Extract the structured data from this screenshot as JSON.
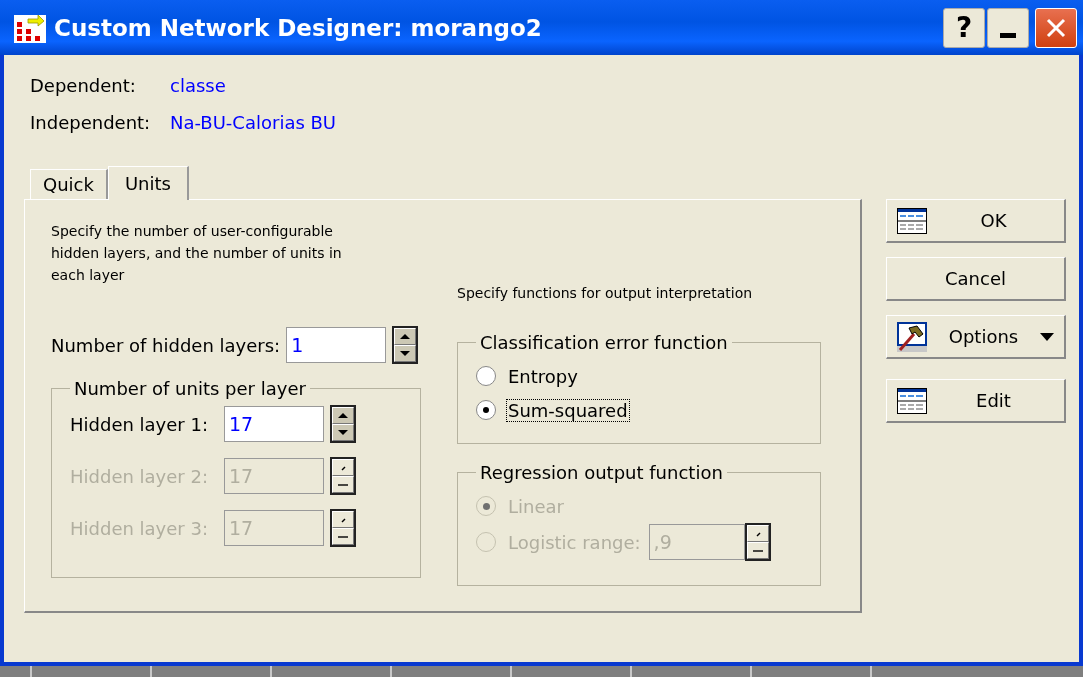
{
  "window": {
    "title": "Custom Network Designer: morango2"
  },
  "title_buttons": [
    {
      "kind": "help",
      "label": "?"
    },
    {
      "kind": "minimize"
    },
    {
      "kind": "close"
    }
  ],
  "variables": [
    {
      "label": "Dependent:",
      "value": "classe"
    },
    {
      "label": "Independent:",
      "value": "Na-BU-Calorias BU"
    }
  ],
  "tabs": [
    {
      "label": "Quick",
      "selected": false
    },
    {
      "label": "Units",
      "selected": true
    }
  ],
  "units_panel": {
    "description": "Specify the number of user-configurable hidden layers, and the number of units in each layer",
    "hidden_layers": {
      "label": "Number of hidden layers:",
      "value": "1"
    },
    "units_group": {
      "title": "Number of units per layer",
      "layers": [
        {
          "label": "Hidden layer 1:",
          "value": "17",
          "disabled": false
        },
        {
          "label": "Hidden layer 2:",
          "value": "17",
          "disabled": true
        },
        {
          "label": "Hidden layer 3:",
          "value": "17",
          "disabled": true
        }
      ]
    }
  },
  "output_panel": {
    "description": "Specify functions for output interpretation",
    "classification": {
      "title": "Classification error function",
      "options": [
        {
          "label": "Entropy",
          "selected": false,
          "disabled": false,
          "focused": false
        },
        {
          "label": "Sum-squared",
          "selected": true,
          "disabled": false,
          "focused": true
        }
      ]
    },
    "regression": {
      "title": "Regression output function",
      "options": [
        {
          "label": "Linear",
          "selected": true,
          "disabled": true,
          "focused": false
        },
        {
          "label": "Logistic range:",
          "selected": false,
          "disabled": true,
          "focused": false,
          "value": ",9"
        }
      ]
    }
  },
  "buttons": [
    {
      "label": "OK",
      "kind": "table",
      "dropdown": false
    },
    {
      "label": "Cancel",
      "kind": "plain",
      "dropdown": false
    },
    {
      "label": "Options",
      "kind": "tool",
      "dropdown": true
    },
    {
      "label": "Edit",
      "kind": "table",
      "dropdown": false
    }
  ]
}
